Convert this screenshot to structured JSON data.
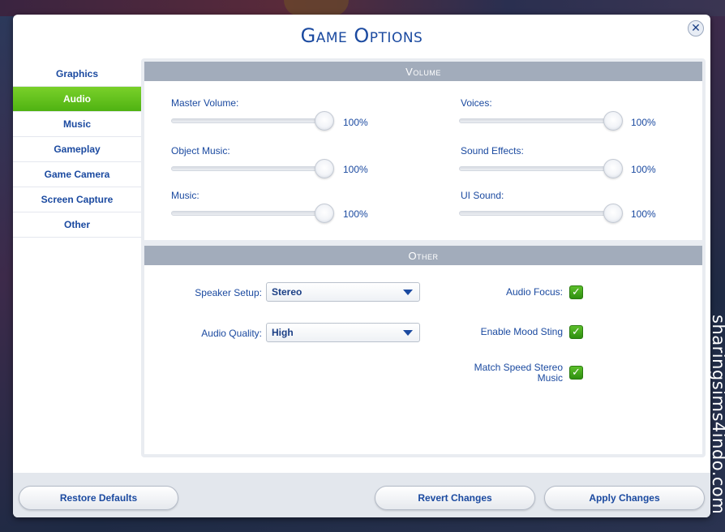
{
  "dialog": {
    "title": "Game Options",
    "close_icon": "close-icon"
  },
  "sidebar": {
    "items": [
      {
        "label": "Graphics",
        "active": false
      },
      {
        "label": "Audio",
        "active": true
      },
      {
        "label": "Music",
        "active": false
      },
      {
        "label": "Gameplay",
        "active": false
      },
      {
        "label": "Game Camera",
        "active": false
      },
      {
        "label": "Screen Capture",
        "active": false
      },
      {
        "label": "Other",
        "active": false
      }
    ],
    "active_color": "#5cbf1f"
  },
  "volume": {
    "header": "Volume",
    "sliders": [
      {
        "label": "Master Volume:",
        "value": "100%",
        "level": 1.0
      },
      {
        "label": "Voices:",
        "value": "100%",
        "level": 1.0
      },
      {
        "label": "Object Music:",
        "value": "100%",
        "level": 1.0
      },
      {
        "label": "Sound Effects:",
        "value": "100%",
        "level": 1.0
      },
      {
        "label": "Music:",
        "value": "100%",
        "level": 1.0
      },
      {
        "label": "UI Sound:",
        "value": "100%",
        "level": 1.0
      }
    ]
  },
  "other": {
    "header": "Other",
    "speaker_setup": {
      "label": "Speaker Setup:",
      "value": "Stereo"
    },
    "audio_quality": {
      "label": "Audio Quality:",
      "value": "High"
    },
    "audio_focus": {
      "label": "Audio Focus:",
      "checked": true
    },
    "mood_sting": {
      "label": "Enable Mood Sting",
      "checked": true
    },
    "match_speed": {
      "label_line1": "Match Speed Stereo",
      "label_line2": "Music",
      "checked": true
    }
  },
  "footer": {
    "restore": "Restore Defaults",
    "revert": "Revert Changes",
    "apply": "Apply Changes"
  },
  "watermark": "sharingsims4indo.com",
  "colors": {
    "accent_blue": "#1b4aa0",
    "header_gray": "#a2acbb",
    "check_green": "#3fa51a"
  }
}
